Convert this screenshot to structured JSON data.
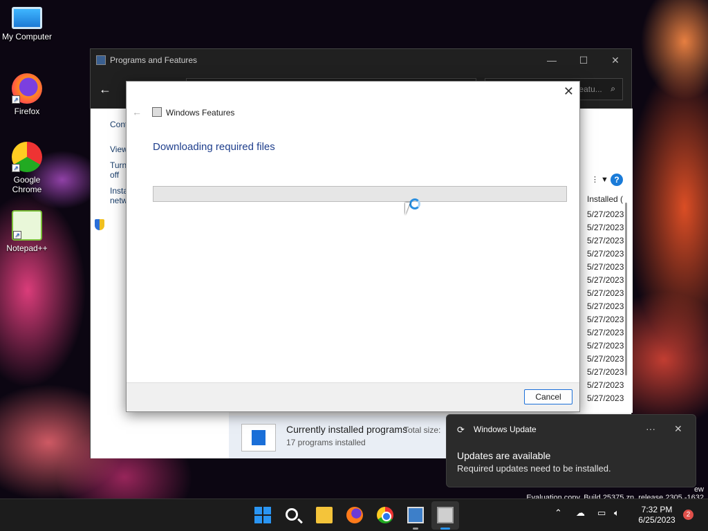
{
  "desktop": {
    "icons": [
      {
        "label": "My Computer"
      },
      {
        "label": "Firefox"
      },
      {
        "label": "Google Chrome"
      },
      {
        "label": "Notepad++"
      }
    ]
  },
  "programs_window": {
    "title": "Programs and Features",
    "search_placeholder": "Search Programs and Featu...",
    "left_links": [
      "Cont",
      "View",
      "Turn\noff",
      "Insta\nnetw"
    ],
    "column_header": "Installed (",
    "installed_dates": [
      "5/27/2023",
      "5/27/2023",
      "5/27/2023",
      "5/27/2023",
      "5/27/2023",
      "5/27/2023",
      "5/27/2023",
      "5/27/2023",
      "5/27/2023",
      "5/27/2023",
      "5/27/2023",
      "5/27/2023",
      "5/27/2023",
      "5/27/2023",
      "5/27/2023"
    ],
    "summary_title": "Currently installed programs",
    "total_size_label": "Total size:",
    "programs_count": "17 programs installed"
  },
  "features_dialog": {
    "title": "Windows Features",
    "heading": "Downloading required files",
    "progress": 0,
    "cancel_label": "Cancel"
  },
  "watermark": {
    "line1": "ew",
    "line2": "Evaluation copy. Build 25375.zn_release.2305 -1632"
  },
  "toast": {
    "app": "Windows Update",
    "more": "···",
    "close": "✕",
    "heading": "Updates are available",
    "body": "Required updates need to be installed."
  },
  "taskbar": {
    "time": "7:32 PM",
    "date": "6/25/2023",
    "notification_count": "2",
    "accent_color": "#2a95f3"
  }
}
